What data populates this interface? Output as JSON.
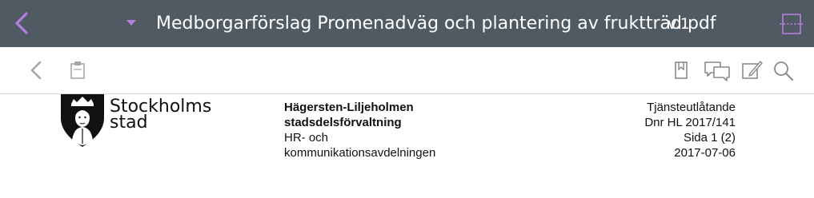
{
  "titlebar": {
    "title": "Medborgarförslag Promenadväg och plantering av fruktträd.pdf",
    "version": "v.1",
    "accent_color": "#b57fe0",
    "background": "#4f5a63",
    "icons": {
      "back": "chevron-left-icon",
      "dropdown": "caret-down-icon",
      "split": "split-view-icon"
    }
  },
  "toolbar": {
    "icons": [
      "chevron-left-icon",
      "clipboard-icon",
      "bookmark-icon",
      "comments-icon",
      "annotate-icon",
      "search-icon"
    ]
  },
  "document": {
    "logo": {
      "line1": "Stockholms",
      "line2": "stad"
    },
    "department": {
      "line1": "Hägersten-Liljeholmen",
      "line2": "stadsdelsförvaltning",
      "line3": "HR- och",
      "line4": "kommunikationsavdelningen"
    },
    "meta": {
      "type": "Tjänsteutlåtande",
      "dnr": "Dnr HL 2017/141",
      "page": "Sida 1 (2)",
      "date": "2017-07-06"
    }
  }
}
